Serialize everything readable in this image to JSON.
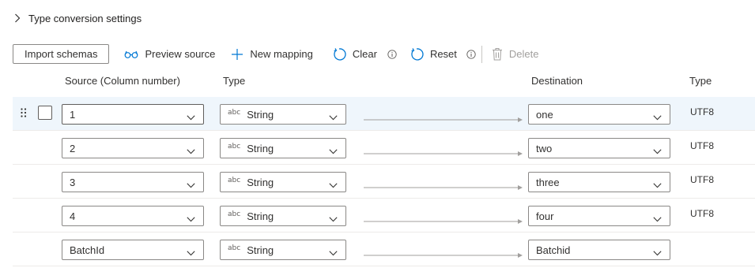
{
  "section": {
    "title": "Type conversion settings"
  },
  "toolbar": {
    "import_schemas": "Import schemas",
    "preview_source": "Preview source",
    "new_mapping": "New mapping",
    "clear": "Clear",
    "reset": "Reset",
    "delete": "Delete"
  },
  "headers": {
    "source": "Source (Column number)",
    "type": "Type",
    "destination": "Destination",
    "dest_type": "Type"
  },
  "rows": [
    {
      "source": "1",
      "type_tag": "abc",
      "type": "String",
      "destination": "one",
      "dest_type": "UTF8",
      "selected": true
    },
    {
      "source": "2",
      "type_tag": "abc",
      "type": "String",
      "destination": "two",
      "dest_type": "UTF8"
    },
    {
      "source": "3",
      "type_tag": "abc",
      "type": "String",
      "destination": "three",
      "dest_type": "UTF8"
    },
    {
      "source": "4",
      "type_tag": "abc",
      "type": "String",
      "destination": "four",
      "dest_type": "UTF8"
    },
    {
      "source": "BatchId",
      "type_tag": "abc",
      "type": "String",
      "destination": "Batchid",
      "dest_type": ""
    }
  ]
}
